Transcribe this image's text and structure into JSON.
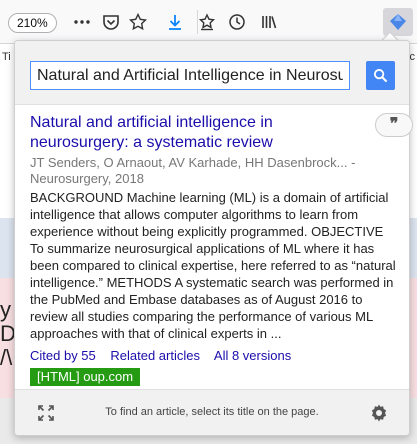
{
  "toolbar": {
    "zoom": "210%",
    "icons": [
      "more-icon",
      "pocket-icon",
      "bookmark-star-icon",
      "download-icon",
      "bookmarks-icon",
      "history-icon",
      "library-icon",
      "scholar-extension-icon"
    ],
    "accent": "#0a84ff"
  },
  "background_page": {
    "tab_left": "Ti",
    "tab_right": "c",
    "letters": [
      "y",
      "D",
      "/\\"
    ]
  },
  "popup": {
    "search": {
      "value": "Natural and Artificial Intelligence in Neurosurgery: A Systematic Review"
    },
    "result": {
      "title": "Natural and artificial intelligence in neurosurgery: a systematic review",
      "cite_label": "❞",
      "authors": "JT Senders, O Arnaout, AV Karhade, HH Dasenbrock... - Neurosurgery, 2018",
      "snippet": "BACKGROUND Machine learning (ML) is a domain of artificial intelligence that allows computer algorithms to learn from experience without being explicitly programmed. OBJECTIVE To summarize neurosurgical applications of ML where it has been compared to clinical expertise, here referred to as “natural intelligence.” METHODS A systematic search was performed in the PubMed and Embase databases as of August 2016 to review all studies comparing the performance of various ML approaches with that of clinical experts in ...",
      "links": {
        "cited_by": "Cited by 55",
        "related": "Related articles",
        "versions": "All 8 versions"
      },
      "html_link": "[HTML] oup.com",
      "colors": {
        "title": "#1a0dab",
        "html_badge": "#249b13",
        "search_button": "#4285f4"
      }
    },
    "footer": {
      "hint": "To find an article, select its title on the page."
    }
  }
}
